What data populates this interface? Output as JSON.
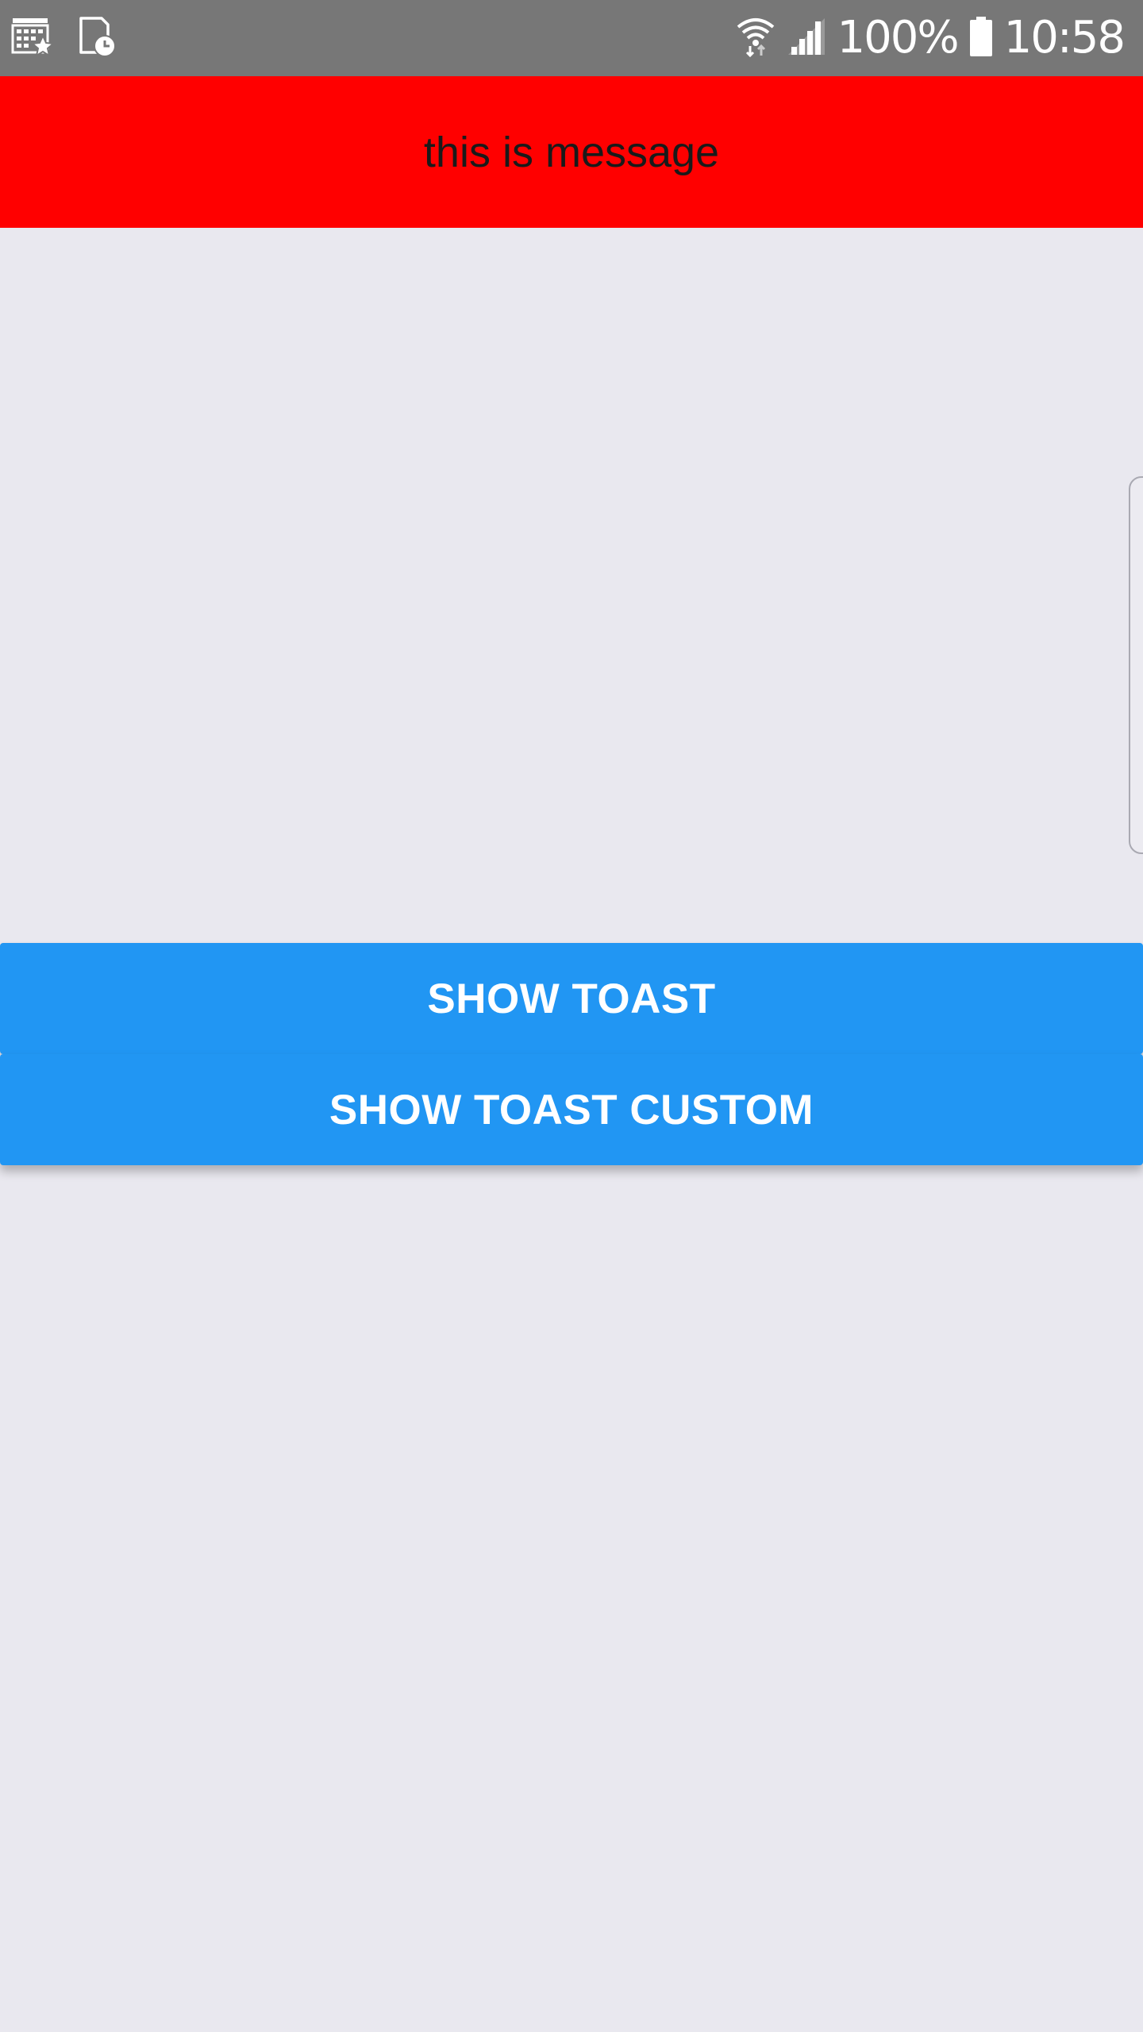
{
  "status_bar": {
    "battery": "100%",
    "time": "10:58",
    "icons": {
      "left": [
        "calendar-star-icon",
        "sim-clock-icon"
      ],
      "right": [
        "wifi-icon",
        "signal-icon",
        "battery-icon"
      ]
    },
    "background_color": "#777777"
  },
  "toast": {
    "message": "this is message",
    "background_color": "#ff0000"
  },
  "buttons": {
    "show_toast": "SHOW TOAST",
    "show_toast_custom": "SHOW TOAST CUSTOM",
    "color": "#2196f3"
  }
}
